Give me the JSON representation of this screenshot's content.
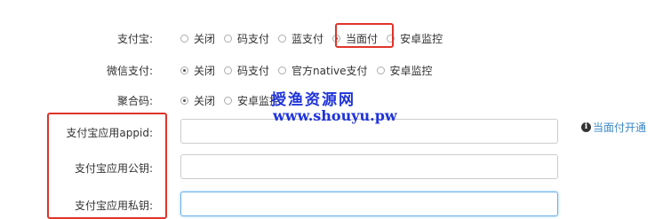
{
  "alipay": {
    "label": "支付宝:",
    "options": [
      "关闭",
      "码支付",
      "蓝支付",
      "当面付",
      "安卓监控"
    ],
    "selected_index": 3
  },
  "wechat": {
    "label": "微信支付:",
    "options": [
      "关闭",
      "码支付",
      "官方native支付",
      "安卓监控"
    ],
    "selected_index": 0
  },
  "aggregate": {
    "label": "聚合码:",
    "options": [
      "关闭",
      "安卓监控"
    ],
    "selected_index": 0
  },
  "fields": {
    "appid_label": "支付宝应用appid:",
    "appid_value": "",
    "public_key_label": "支付宝应用公钥:",
    "public_key_value": "",
    "private_key_label": "支付宝应用私钥:",
    "private_key_value": ""
  },
  "help": {
    "icon": "info-icon",
    "text": "当面付开通"
  },
  "watermark": {
    "line1": "授渔资源网",
    "line2": "www.shouyu.pw"
  },
  "colors": {
    "annotation_red": "#e0342a",
    "watermark_blue": "#1f33d9",
    "link_blue": "#3a87c8",
    "focus_blue": "#66afe9"
  }
}
